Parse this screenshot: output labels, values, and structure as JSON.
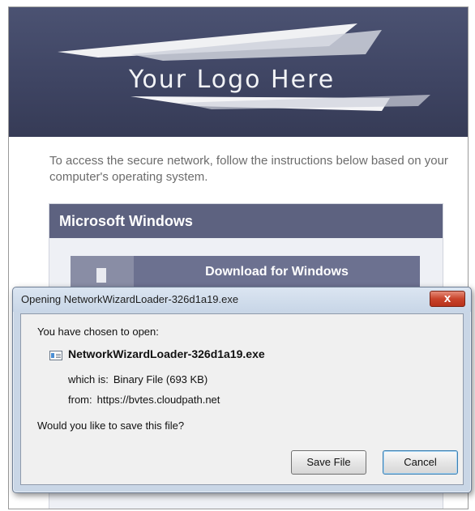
{
  "banner": {
    "logo_text": "Your Logo Here"
  },
  "intro": {
    "text": "To access the secure network, follow the instructions below based on your computer's operating system."
  },
  "os_panel": {
    "header": "Microsoft Windows",
    "download_label": "Download for Windows"
  },
  "dialog": {
    "title": "Opening NetworkWizardLoader-326d1a19.exe",
    "close_label": "x",
    "chosen_label": "You have chosen to open:",
    "file_name": "NetworkWizardLoader-326d1a19.exe",
    "which_key": "which is:",
    "which_value": "Binary File (693 KB)",
    "from_key": "from:",
    "from_value": "https://bvtes.cloudpath.net",
    "question": "Would you like to save this file?",
    "save_label": "Save File",
    "cancel_label": "Cancel"
  },
  "colors": {
    "banner": "#3e4462",
    "panel_header": "#5d6280",
    "close_button": "#c9442c"
  }
}
